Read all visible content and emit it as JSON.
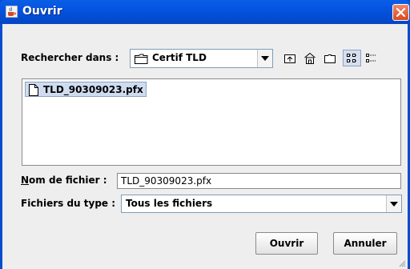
{
  "window": {
    "title": "Ouvrir"
  },
  "look_in": {
    "label": "Rechercher dans :",
    "value": "Certif TLD"
  },
  "toolbar": {
    "buttons": [
      {
        "name": "up-one-level",
        "icon": "up-folder-icon"
      },
      {
        "name": "home",
        "icon": "home-icon"
      },
      {
        "name": "new-folder",
        "icon": "new-folder-icon"
      },
      {
        "name": "list-view",
        "icon": "list-view-icon",
        "selected": true
      },
      {
        "name": "details-view",
        "icon": "details-view-icon",
        "selected": false
      }
    ]
  },
  "file_list": {
    "items": [
      {
        "name": "TLD_90309023.pfx",
        "icon": "file-icon",
        "selected": true
      }
    ]
  },
  "file_name": {
    "label_mnemonic": "N",
    "label_rest": "om de fichier :",
    "value": "TLD_90309023.pfx"
  },
  "file_type": {
    "label": "Fichiers du type :",
    "value": "Tous les fichiers"
  },
  "buttons": {
    "open": "Ouvrir",
    "cancel": "Annuler"
  },
  "colors": {
    "title_bar": "#0553e0",
    "dialog_background": "#eeeeee",
    "selection": "#cfdcf0",
    "close_button": "#d8491c"
  }
}
